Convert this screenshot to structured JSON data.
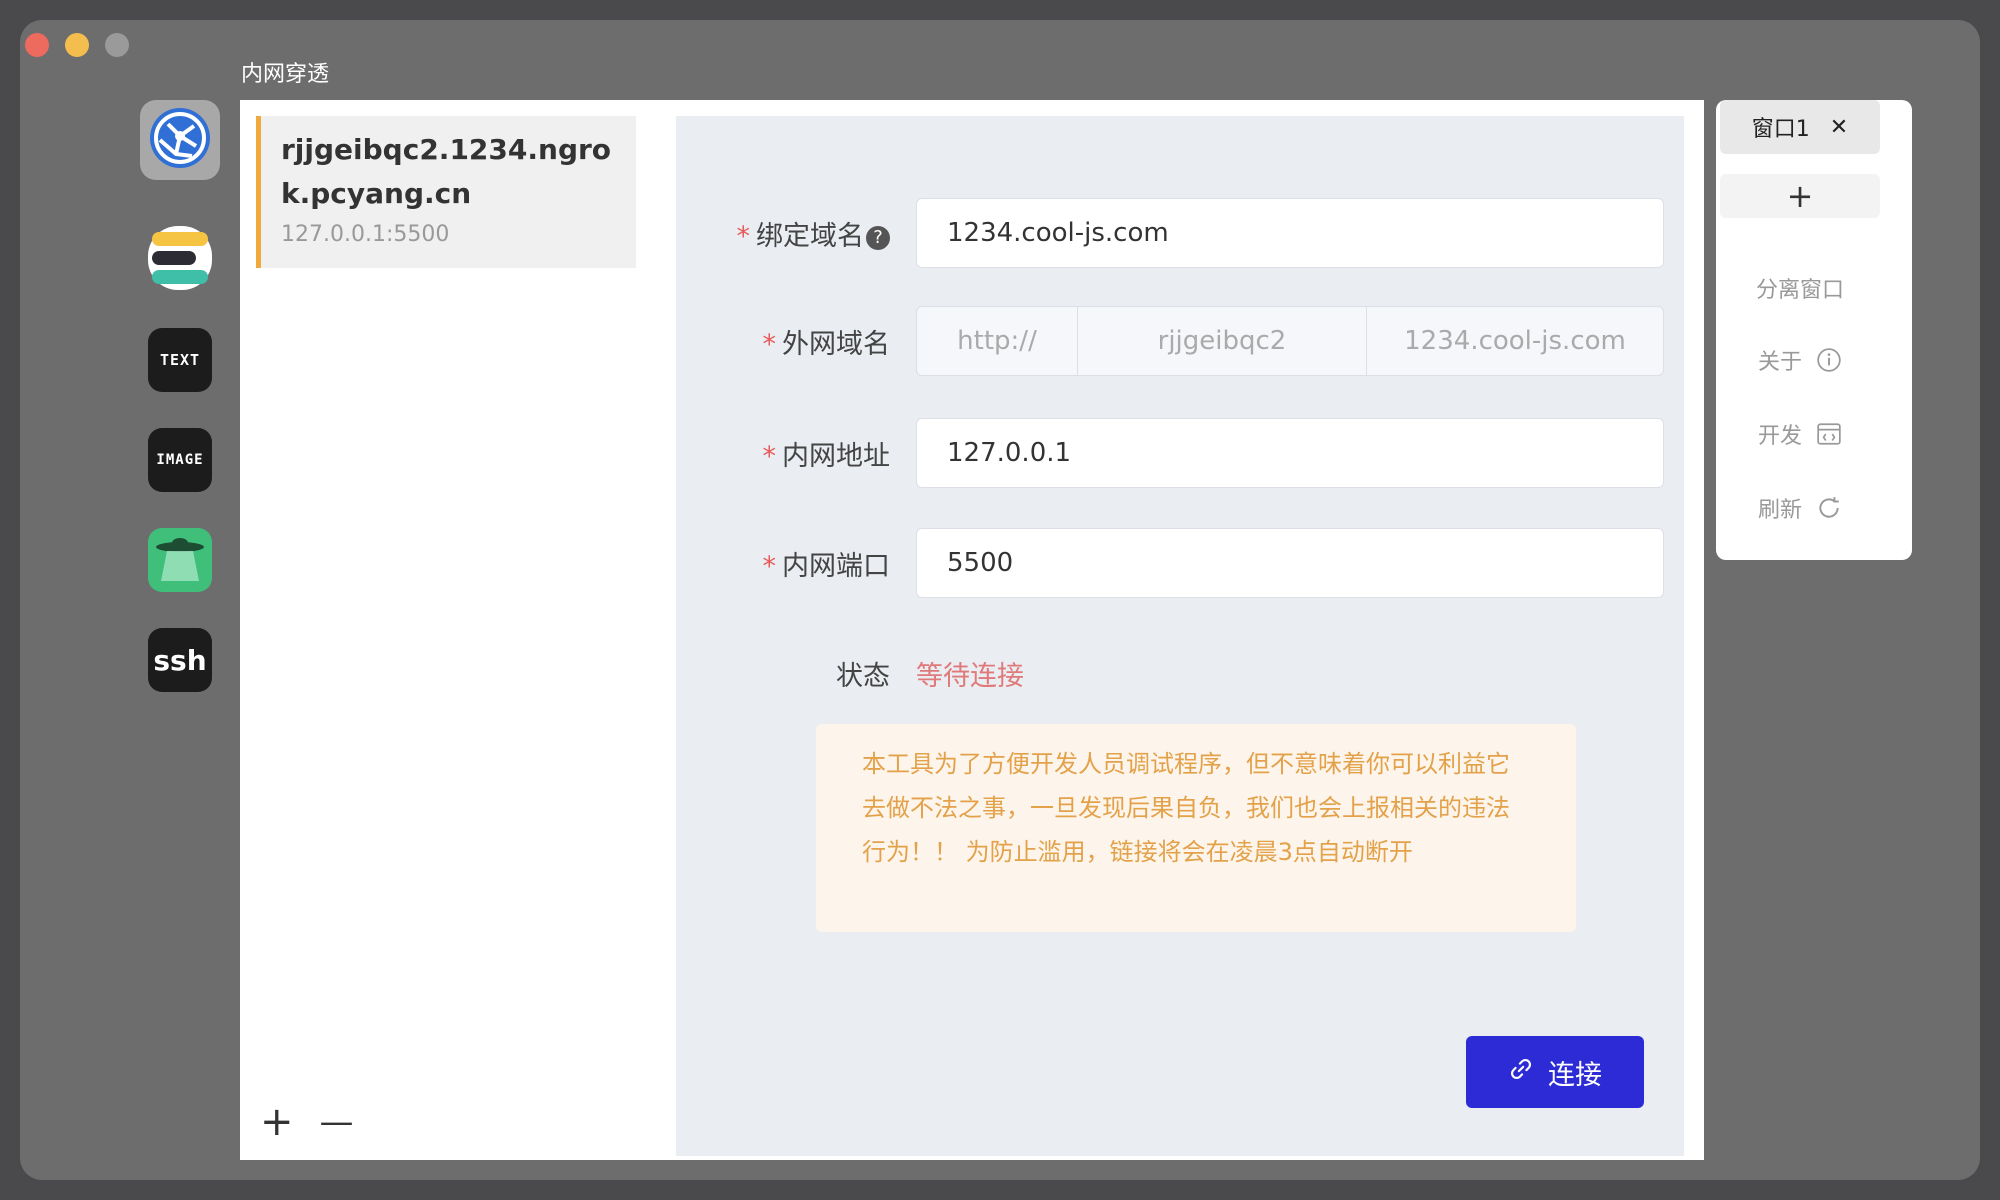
{
  "app": {
    "title": "内网穿透"
  },
  "dock": {
    "items": [
      {
        "name": "network-tool",
        "icon": "globe-icon"
      },
      {
        "name": "db-tool",
        "icon": "stack-icon"
      },
      {
        "name": "text-tool",
        "icon_text": "TEXT"
      },
      {
        "name": "image-tool",
        "icon_text": "IMAGE"
      },
      {
        "name": "ufo-tool",
        "icon": "ufo-icon"
      },
      {
        "name": "ssh-tool",
        "icon_text": "ssh"
      }
    ]
  },
  "list": {
    "items": [
      {
        "host": "rjjgeibqc2.1234.ngrok.pcyang.cn",
        "address": "127.0.0.1:5500"
      }
    ],
    "add_label": "+",
    "remove_label": "—"
  },
  "form": {
    "bind_domain": {
      "label": "绑定域名",
      "value": "1234.cool-js.com"
    },
    "public_domain": {
      "label": "外网域名",
      "protocol": "http://",
      "subdomain": "rjjgeibqc2",
      "domain": "1234.cool-js.com"
    },
    "local_address": {
      "label": "内网地址",
      "value": "127.0.0.1"
    },
    "local_port": {
      "label": "内网端口",
      "value": "5500"
    },
    "status": {
      "label": "状态",
      "value": "等待连接"
    },
    "notice": "本工具为了方便开发人员调试程序，但不意味着你可以利益它去做不法之事，一旦发现后果自负，我们也会上报相关的违法行为！！ 为防止滥用，链接将会在凌晨3点自动断开",
    "connect_label": "连接"
  },
  "sidebar": {
    "tab_label": "窗口1",
    "add_tab_label": "+",
    "menu": [
      {
        "label": "分离窗口",
        "icon": ""
      },
      {
        "label": "关于",
        "icon": "info-icon"
      },
      {
        "label": "开发",
        "icon": "code-icon"
      },
      {
        "label": "刷新",
        "icon": "refresh-icon"
      }
    ]
  },
  "colors": {
    "accent": "#2c2bd6",
    "required": "#e85a5a",
    "status_waiting": "#e07a7a",
    "notice_text": "#e3a24a",
    "list_marker": "#f2a93b"
  }
}
